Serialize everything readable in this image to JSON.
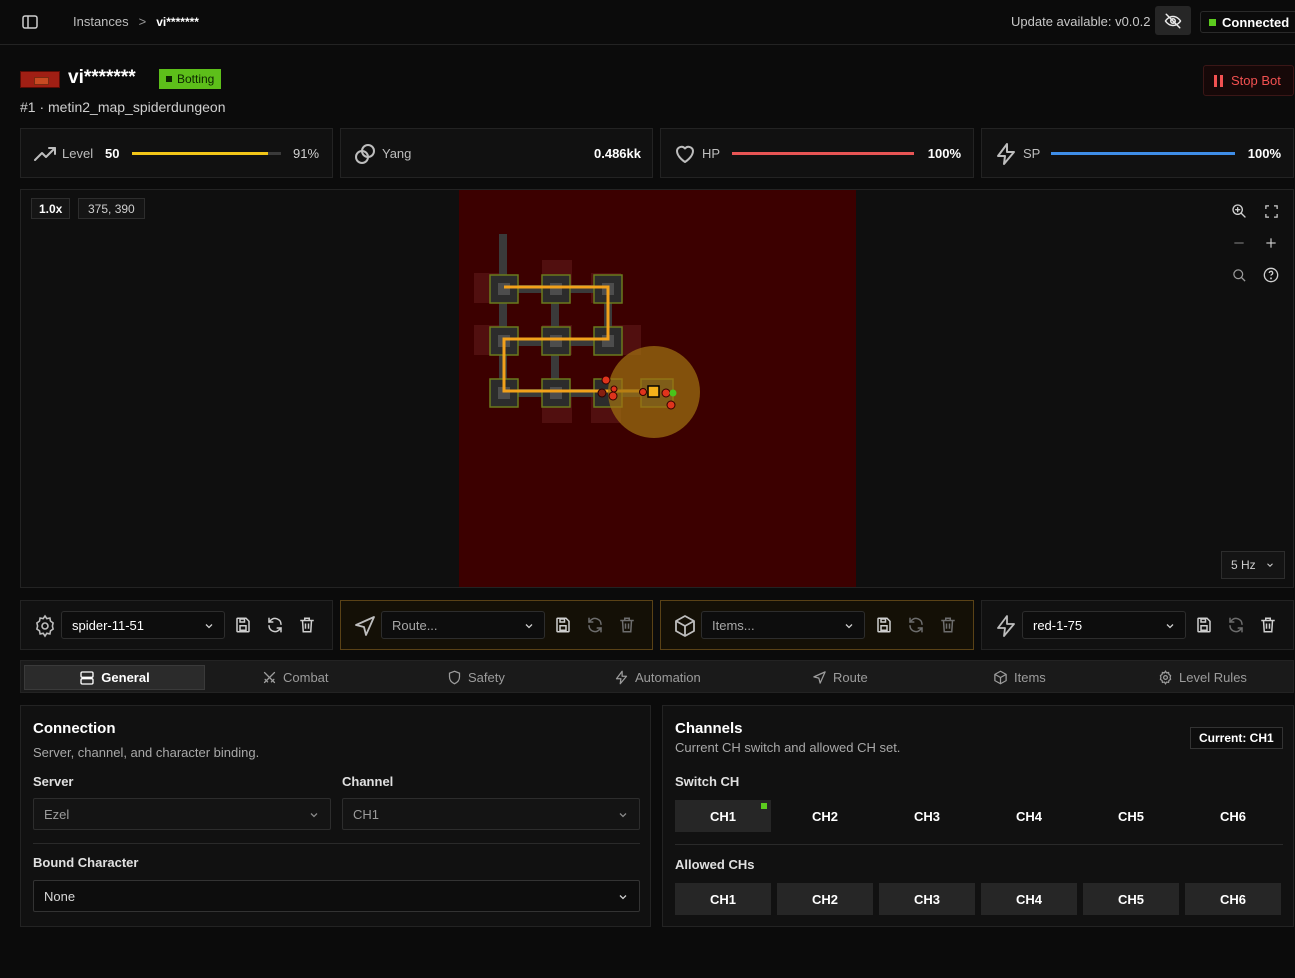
{
  "breadcrumb": {
    "root": "Instances",
    "separator": ">",
    "current": "vi*******"
  },
  "topbar": {
    "update_text": "Update available: v0.0.2",
    "connection_status": "Connected"
  },
  "instance": {
    "name": "vi*******",
    "status": "Botting",
    "subtitle": "#1 · metin2_map_spiderdungeon",
    "stop_label": "Stop Bot"
  },
  "stats": {
    "level": {
      "label": "Level",
      "value": "50",
      "percent_text": "91%",
      "progress": 0.91
    },
    "yang": {
      "label": "Yang",
      "value": "0.486kk"
    },
    "hp": {
      "label": "HP",
      "percent_text": "100%",
      "progress": 1.0
    },
    "sp": {
      "label": "SP",
      "percent_text": "100%",
      "progress": 1.0
    }
  },
  "map": {
    "zoom": "1.0x",
    "coords": "375, 390",
    "rate": "5 Hz"
  },
  "profiles": {
    "settings": {
      "value": "spider-11-51"
    },
    "route": {
      "placeholder": "Route..."
    },
    "items": {
      "placeholder": "Items..."
    },
    "level_rules": {
      "value": "red-1-75"
    }
  },
  "tabs": [
    "General",
    "Combat",
    "Safety",
    "Automation",
    "Route",
    "Items",
    "Level Rules"
  ],
  "connection": {
    "title": "Connection",
    "description": "Server, channel, and character binding.",
    "server_label": "Server",
    "server_value": "Ezel",
    "channel_label": "Channel",
    "channel_value": "CH1",
    "bound_label": "Bound Character",
    "bound_value": "None"
  },
  "channels": {
    "title": "Channels",
    "description": "Current CH switch and allowed CH set.",
    "current": "Current: CH1",
    "switch_label": "Switch CH",
    "allowed_label": "Allowed CHs",
    "list": [
      "CH1",
      "CH2",
      "CH3",
      "CH4",
      "CH5",
      "CH6"
    ]
  },
  "colors": {
    "accent_green": "#5ccb1e",
    "level_bar": "#f2c618",
    "hp_bar": "#e85555",
    "sp_bar": "#3f8ee8",
    "danger": "#f25151",
    "route": "#f2a11b"
  }
}
